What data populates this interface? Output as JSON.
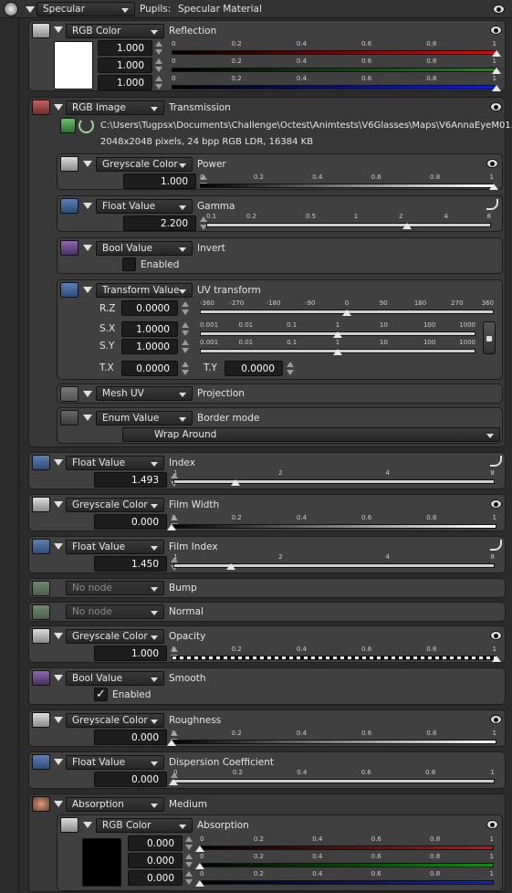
{
  "header": {
    "node_type": "Specular",
    "pin_label": "Pupils:",
    "material": "Specular Material"
  },
  "reflection": {
    "type": "RGB Color",
    "label": "Reflection",
    "values": [
      "1.000",
      "1.000",
      "1.000"
    ],
    "ticks": [
      "0",
      "0.2",
      "0.4",
      "0.6",
      "0.8",
      "1"
    ],
    "level": 1.0
  },
  "transmission": {
    "type": "RGB Image",
    "label": "Transmission",
    "path": "C:\\Users\\Tugpsx\\Documents\\Challenge\\Octest\\Animtests\\V6Glasses\\Maps\\V6AnnaEyeM01.jpg",
    "info": "2048x2048 pixels, 24 bpp RGB LDR, 16384 KB"
  },
  "power": {
    "type": "Greyscale Color",
    "label": "Power",
    "value": "1.000",
    "ticks": [
      "0",
      "0.2",
      "0.4",
      "0.6",
      "0.8",
      "1"
    ],
    "level": 1.0
  },
  "gamma": {
    "type": "Float Value",
    "label": "Gamma",
    "value": "2.200",
    "ticks": [
      "0.1",
      "0.2",
      "0.5",
      "1",
      "2",
      "4",
      "8"
    ]
  },
  "invert": {
    "type": "Bool Value",
    "label": "Invert",
    "checkbox": "Enabled"
  },
  "uv": {
    "type": "Transform Value",
    "label": "UV transform",
    "rz_label": "R.Z",
    "rz": "0.0000",
    "rz_ticks": [
      "-360",
      "-270",
      "-180",
      "-90",
      "0",
      "90",
      "180",
      "270",
      "360"
    ],
    "sx_label": "S.X",
    "sx": "1.0000",
    "sy_label": "S.Y",
    "sy": "1.0000",
    "s_ticks": [
      "0.001",
      "0.01",
      "0.1",
      "1",
      "10",
      "100",
      "1000"
    ],
    "tx_label": "T.X",
    "tx": "0.0000",
    "ty_label": "T.Y",
    "ty": "0.0000"
  },
  "projection": {
    "type": "Mesh UV",
    "label": "Projection"
  },
  "border": {
    "type": "Enum Value",
    "label": "Border mode",
    "option": "Wrap Around"
  },
  "index": {
    "type": "Float Value",
    "label": "Index",
    "value": "1.493",
    "ticks": [
      "1",
      "2",
      "4",
      "8"
    ]
  },
  "film_width": {
    "type": "Greyscale Color",
    "label": "Film Width",
    "value": "0.000",
    "ticks": [
      "0",
      "0.2",
      "0.4",
      "0.6",
      "0.8",
      "1"
    ],
    "level": 0.0
  },
  "film_index": {
    "type": "Float Value",
    "label": "Film Index",
    "value": "1.450",
    "ticks": [
      "1",
      "2",
      "4",
      "8"
    ]
  },
  "bump": {
    "type": "No node",
    "label": "Bump"
  },
  "normal": {
    "type": "No node",
    "label": "Normal"
  },
  "opacity": {
    "type": "Greyscale Color",
    "label": "Opacity",
    "value": "1.000",
    "ticks": [
      "0",
      "0.2",
      "0.4",
      "0.6",
      "0.8",
      "1"
    ],
    "level": 1.0
  },
  "smooth": {
    "type": "Bool Value",
    "label": "Smooth",
    "checkbox": "Enabled",
    "checked": "✓"
  },
  "roughness": {
    "type": "Greyscale Color",
    "label": "Roughness",
    "value": "0.000",
    "ticks": [
      "0",
      "0.2",
      "0.4",
      "0.6",
      "0.8",
      "1"
    ],
    "level": 0.0
  },
  "dispersion": {
    "type": "Float Value",
    "label": "Dispersion Coefficient",
    "value": "0.000",
    "ticks": [
      "0",
      "0.2",
      "0.4",
      "0.6",
      "0.8",
      "1"
    ],
    "level": 0.0
  },
  "medium": {
    "type": "Absorption",
    "label": "Medium"
  },
  "absorption": {
    "type": "RGB Color",
    "label": "Absorption",
    "values": [
      "0.000",
      "0.000",
      "0.000"
    ],
    "ticks": [
      "0",
      "0.2",
      "0.4",
      "0.6",
      "0.8",
      "1"
    ],
    "level": 0.0
  },
  "colors": {
    "red": "#d01010",
    "green": "#109010",
    "blue": "#1020d0",
    "panel": "#404040"
  }
}
